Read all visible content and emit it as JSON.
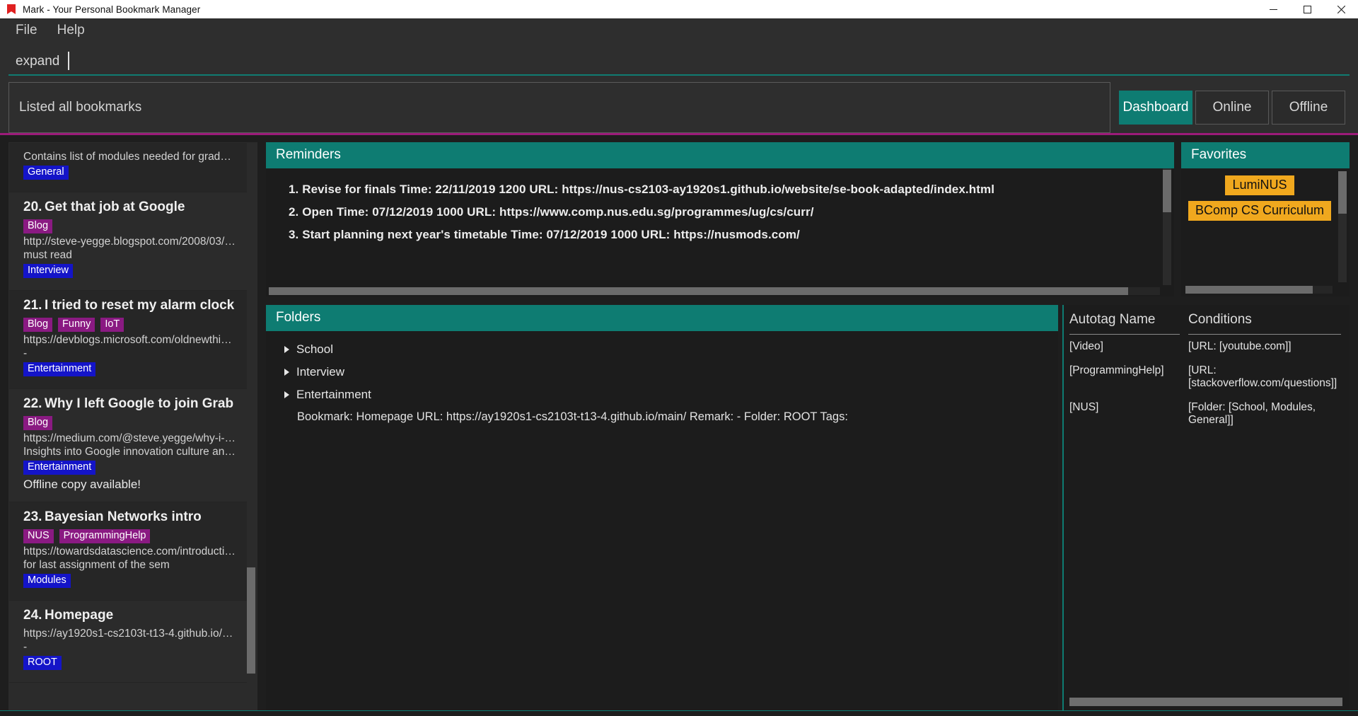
{
  "window": {
    "title": "Mark - Your Personal Bookmark Manager",
    "icon": "bookmark-flag-icon",
    "controls": {
      "minimize": "minimize-icon",
      "maximize": "maximize-icon",
      "close": "close-icon"
    }
  },
  "menu": {
    "items": [
      "File",
      "Help"
    ]
  },
  "search": {
    "value": "expand",
    "placeholder": ""
  },
  "result": {
    "text": "Listed all bookmarks"
  },
  "view_tabs": {
    "items": [
      "Dashboard",
      "Online",
      "Offline"
    ],
    "active": "Dashboard"
  },
  "bookmarks": [
    {
      "index": "",
      "title": "",
      "tags": [],
      "url": "",
      "remark": "Contains list of modules needed for graduation",
      "folders": [
        "General"
      ],
      "offline": ""
    },
    {
      "index": "20.",
      "title": "Get that job at Google",
      "tags": [
        "Blog"
      ],
      "url": "http://steve-yegge.blogspot.com/2008/03/get-...",
      "remark": "must read",
      "folders": [
        "Interview"
      ],
      "offline": ""
    },
    {
      "index": "21.",
      "title": "I tried to reset my alarm clock",
      "tags": [
        "Blog",
        "Funny",
        "IoT"
      ],
      "url": "https://devblogs.microsoft.com/oldnewthing/2...",
      "remark": "-",
      "folders": [
        "Entertainment"
      ],
      "offline": ""
    },
    {
      "index": "22.",
      "title": "Why I left Google to join Grab",
      "tags": [
        "Blog"
      ],
      "url": "https://medium.com/@steve.yegge/why-i-left-...",
      "remark": "Insights into Google innovation culture and Gra...",
      "folders": [
        "Entertainment"
      ],
      "offline": "Offline copy available!"
    },
    {
      "index": "23.",
      "title": "Bayesian Networks intro",
      "tags": [
        "NUS",
        "ProgrammingHelp"
      ],
      "url": "https://towardsdatascience.com/introduction-t...",
      "remark": "for last assignment of the sem",
      "folders": [
        "Modules"
      ],
      "offline": ""
    },
    {
      "index": "24.",
      "title": "Homepage",
      "tags": [],
      "url": "https://ay1920s1-cs2103t-t13-4.github.io/main/",
      "remark": "-",
      "folders": [
        "ROOT"
      ],
      "offline": ""
    }
  ],
  "reminders": {
    "title": "Reminders",
    "items": [
      "1. Revise for finals Time: 22/11/2019 1200 URL: https://nus-cs2103-ay1920s1.github.io/website/se-book-adapted/index.html",
      "2. Open Time: 07/12/2019 1000 URL: https://www.comp.nus.edu.sg/programmes/ug/cs/curr/",
      "3. Start planning next year's timetable Time: 07/12/2019 1000 URL: https://nusmods.com/"
    ]
  },
  "favorites": {
    "title": "Favorites",
    "items": [
      "LumiNUS",
      "BComp CS Curriculum"
    ]
  },
  "folders_panel": {
    "title": "Folders",
    "tree": [
      "School",
      "Interview",
      "Entertainment"
    ],
    "detail": "Bookmark: Homepage URL: https://ay1920s1-cs2103t-t13-4.github.io/main/ Remark: - Folder: ROOT Tags:"
  },
  "autotag": {
    "columns": [
      "Autotag Name",
      "Conditions"
    ],
    "rows": [
      {
        "name": "[Video]",
        "condition": "[URL: [youtube.com]]"
      },
      {
        "name": "[ProgrammingHelp]",
        "condition": "[URL: [stackoverflow.com/questions]]"
      },
      {
        "name": "[NUS]",
        "condition": "[Folder: [School, Modules, General]]"
      }
    ]
  },
  "colors": {
    "accent_teal": "#0e7c72",
    "tag_purple": "#8a1a82",
    "tag_blue": "#1414c8",
    "favorite_orange": "#f0a81e",
    "magenta_divider": "#9c1b7a",
    "background": "#1e1e1e"
  }
}
